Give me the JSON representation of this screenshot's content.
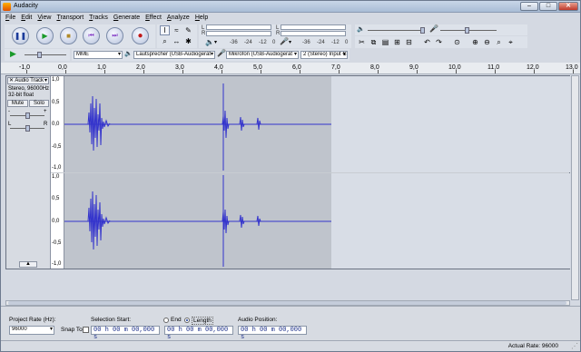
{
  "window": {
    "title": "Audacity",
    "min_icon": "minimize-icon",
    "max_icon": "maximize-icon",
    "close_icon": "close-icon"
  },
  "menu": [
    "File",
    "Edit",
    "View",
    "Transport",
    "Tracks",
    "Generate",
    "Effect",
    "Analyze",
    "Help"
  ],
  "meters": {
    "play_labels": [
      "-36",
      "-24",
      "-12",
      "0"
    ],
    "rec_labels": [
      "-36",
      "-24",
      "-12",
      "0"
    ],
    "left": "L",
    "right": "R"
  },
  "device": {
    "host": "MME",
    "output": "Lautsprecher (USB-Audiogerät",
    "input": "Mikrofon (USB-Audiogerät",
    "channels": "2 (Stereo) Input C"
  },
  "ruler": {
    "labels": [
      "-1,0",
      "0,0",
      "1,0",
      "2,0",
      "3,0",
      "4,0",
      "5,0",
      "6,0",
      "7,0",
      "8,0",
      "9,0",
      "10,0",
      "11,0",
      "12,0",
      "13,0"
    ]
  },
  "track": {
    "name": "Audio Track",
    "rate": "Stereo, 96000Hz",
    "format": "32-bit float",
    "mute": "Mute",
    "solo": "Solo",
    "gain_minus": "-",
    "gain_plus": "+",
    "pan_left": "L",
    "pan_right": "R",
    "collapse_icon": "collapse-arrow-icon",
    "scale": [
      "1,0",
      "0,5",
      "0,0",
      "-0,5",
      "-1,0"
    ]
  },
  "status": {
    "project_rate_label": "Project Rate (Hz):",
    "project_rate": "96000",
    "snap_to": "Snap To",
    "selection_start_label": "Selection Start:",
    "selection_start": "00 h 00 m 00,000 s",
    "end_label": "End",
    "length_label": "Length",
    "length_value": "00 h 00 m 00,000 s",
    "audio_position_label": "Audio Position:",
    "audio_position": "00 h 00 m 00,000 s",
    "actual_rate": "Actual Rate: 96000"
  },
  "colors": {
    "wave": "#3333cc",
    "selection": "#bfc4cc",
    "background": "#d8dde6"
  }
}
